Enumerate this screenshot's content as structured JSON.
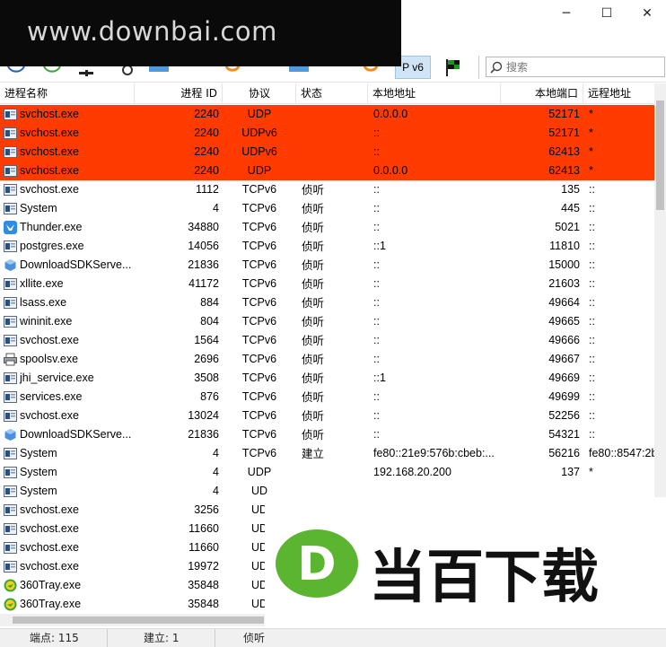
{
  "window": {
    "minimize": "─",
    "maximize": "☐",
    "close": "✕"
  },
  "watermark": "www.downbai.com",
  "toolbar": {
    "ipv6_label": "P v6",
    "search_placeholder": "搜索"
  },
  "columns": [
    "进程名称",
    "进程 ID",
    "协议",
    "状态",
    "本地地址",
    "本地端口",
    "远程地址"
  ],
  "rows": [
    {
      "name": "svchost.exe",
      "pid": "2240",
      "proto": "UDP",
      "state": "",
      "laddr": "0.0.0.0",
      "lport": "52171",
      "raddr": "*",
      "highlight": true,
      "icon": "service"
    },
    {
      "name": "svchost.exe",
      "pid": "2240",
      "proto": "UDPv6",
      "state": "",
      "laddr": "::",
      "lport": "52171",
      "raddr": "*",
      "highlight": true,
      "icon": "service"
    },
    {
      "name": "svchost.exe",
      "pid": "2240",
      "proto": "UDPv6",
      "state": "",
      "laddr": "::",
      "lport": "62413",
      "raddr": "*",
      "highlight": true,
      "icon": "service"
    },
    {
      "name": "svchost.exe",
      "pid": "2240",
      "proto": "UDP",
      "state": "",
      "laddr": "0.0.0.0",
      "lport": "62413",
      "raddr": "*",
      "highlight": true,
      "icon": "service"
    },
    {
      "name": "svchost.exe",
      "pid": "1112",
      "proto": "TCPv6",
      "state": "侦听",
      "laddr": "::",
      "lport": "135",
      "raddr": "::",
      "highlight": false,
      "icon": "service"
    },
    {
      "name": "System",
      "pid": "4",
      "proto": "TCPv6",
      "state": "侦听",
      "laddr": "::",
      "lport": "445",
      "raddr": "::",
      "highlight": false,
      "icon": "service"
    },
    {
      "name": "Thunder.exe",
      "pid": "34880",
      "proto": "TCPv6",
      "state": "侦听",
      "laddr": "::",
      "lport": "5021",
      "raddr": "::",
      "highlight": false,
      "icon": "thunder"
    },
    {
      "name": "postgres.exe",
      "pid": "14056",
      "proto": "TCPv6",
      "state": "侦听",
      "laddr": "::1",
      "lport": "11810",
      "raddr": "::",
      "highlight": false,
      "icon": "service"
    },
    {
      "name": "DownloadSDKServe...",
      "pid": "21836",
      "proto": "TCPv6",
      "state": "侦听",
      "laddr": "::",
      "lport": "15000",
      "raddr": "::",
      "highlight": false,
      "icon": "cube"
    },
    {
      "name": "xllite.exe",
      "pid": "41172",
      "proto": "TCPv6",
      "state": "侦听",
      "laddr": "::",
      "lport": "21603",
      "raddr": "::",
      "highlight": false,
      "icon": "service"
    },
    {
      "name": "lsass.exe",
      "pid": "884",
      "proto": "TCPv6",
      "state": "侦听",
      "laddr": "::",
      "lport": "49664",
      "raddr": "::",
      "highlight": false,
      "icon": "service"
    },
    {
      "name": "wininit.exe",
      "pid": "804",
      "proto": "TCPv6",
      "state": "侦听",
      "laddr": "::",
      "lport": "49665",
      "raddr": "::",
      "highlight": false,
      "icon": "service"
    },
    {
      "name": "svchost.exe",
      "pid": "1564",
      "proto": "TCPv6",
      "state": "侦听",
      "laddr": "::",
      "lport": "49666",
      "raddr": "::",
      "highlight": false,
      "icon": "service"
    },
    {
      "name": "spoolsv.exe",
      "pid": "2696",
      "proto": "TCPv6",
      "state": "侦听",
      "laddr": "::",
      "lport": "49667",
      "raddr": "::",
      "highlight": false,
      "icon": "printer"
    },
    {
      "name": "jhi_service.exe",
      "pid": "3508",
      "proto": "TCPv6",
      "state": "侦听",
      "laddr": "::1",
      "lport": "49669",
      "raddr": "::",
      "highlight": false,
      "icon": "service"
    },
    {
      "name": "services.exe",
      "pid": "876",
      "proto": "TCPv6",
      "state": "侦听",
      "laddr": "::",
      "lport": "49699",
      "raddr": "::",
      "highlight": false,
      "icon": "service"
    },
    {
      "name": "svchost.exe",
      "pid": "13024",
      "proto": "TCPv6",
      "state": "侦听",
      "laddr": "::",
      "lport": "52256",
      "raddr": "::",
      "highlight": false,
      "icon": "service"
    },
    {
      "name": "DownloadSDKServe...",
      "pid": "21836",
      "proto": "TCPv6",
      "state": "侦听",
      "laddr": "::",
      "lport": "54321",
      "raddr": "::",
      "highlight": false,
      "icon": "cube"
    },
    {
      "name": "System",
      "pid": "4",
      "proto": "TCPv6",
      "state": "建立",
      "laddr": "fe80::21e9:576b:cbeb:...",
      "lport": "56216",
      "raddr": "fe80::8547:2b",
      "highlight": false,
      "icon": "service"
    },
    {
      "name": "System",
      "pid": "4",
      "proto": "UDP",
      "state": "",
      "laddr": "192.168.20.200",
      "lport": "137",
      "raddr": "*",
      "highlight": false,
      "icon": "service"
    },
    {
      "name": "System",
      "pid": "4",
      "proto": "UD",
      "state": "",
      "laddr": "",
      "lport": "",
      "raddr": "",
      "highlight": false,
      "icon": "service"
    },
    {
      "name": "svchost.exe",
      "pid": "3256",
      "proto": "UD",
      "state": "",
      "laddr": "",
      "lport": "",
      "raddr": "",
      "highlight": false,
      "icon": "service"
    },
    {
      "name": "svchost.exe",
      "pid": "11660",
      "proto": "UD",
      "state": "",
      "laddr": "",
      "lport": "",
      "raddr": "",
      "highlight": false,
      "icon": "service"
    },
    {
      "name": "svchost.exe",
      "pid": "11660",
      "proto": "UD",
      "state": "",
      "laddr": "",
      "lport": "",
      "raddr": "",
      "highlight": false,
      "icon": "service"
    },
    {
      "name": "svchost.exe",
      "pid": "19972",
      "proto": "UD",
      "state": "",
      "laddr": "",
      "lport": "",
      "raddr": "",
      "highlight": false,
      "icon": "service"
    },
    {
      "name": "360Tray.exe",
      "pid": "35848",
      "proto": "UD",
      "state": "",
      "laddr": "",
      "lport": "",
      "raddr": "",
      "highlight": false,
      "icon": "tray360"
    },
    {
      "name": "360Tray.exe",
      "pid": "35848",
      "proto": "UD",
      "state": "",
      "laddr": "",
      "lport": "",
      "raddr": "",
      "highlight": false,
      "icon": "tray360"
    }
  ],
  "status": {
    "endpoints": "端点: 115",
    "established": "建立: 1",
    "listening": "侦听"
  },
  "logo": {
    "letter": "D",
    "text": "当百下载"
  },
  "colors": {
    "highlight": "#ff3b00",
    "logo_green": "#5cb531"
  }
}
